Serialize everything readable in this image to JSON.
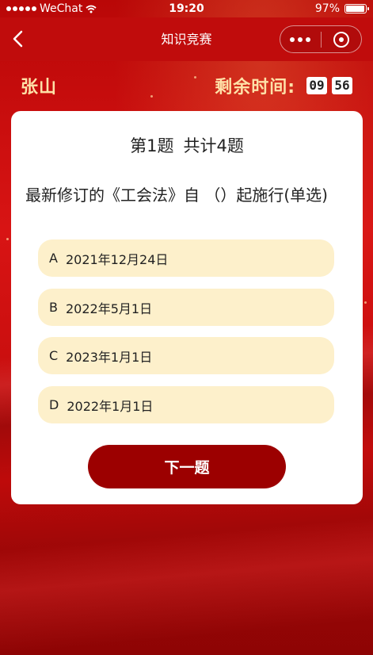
{
  "status_bar": {
    "carrier": "WeChat",
    "time": "19:20",
    "battery_percent": "97%",
    "battery_level": 0.97
  },
  "nav": {
    "title": "知识竞赛"
  },
  "header": {
    "username": "张山",
    "timer_label": "剩余时间:",
    "minutes": "09",
    "seconds": "56"
  },
  "question": {
    "number_label": "第1题",
    "total_label": "共计4题",
    "text": "最新修订的《工会法》自 （）起施行(单选)",
    "options": [
      {
        "letter": "A",
        "text": "2021年12月24日"
      },
      {
        "letter": "B",
        "text": "2022年5月1日"
      },
      {
        "letter": "C",
        "text": "2023年1月1日"
      },
      {
        "letter": "D",
        "text": "2022年1月1日"
      }
    ]
  },
  "actions": {
    "next_label": "下一题"
  },
  "colors": {
    "background": "#c80a0a",
    "accent_text": "#ffe1a8",
    "option_bg": "#fdf0cb",
    "button_bg": "#9c0000"
  }
}
